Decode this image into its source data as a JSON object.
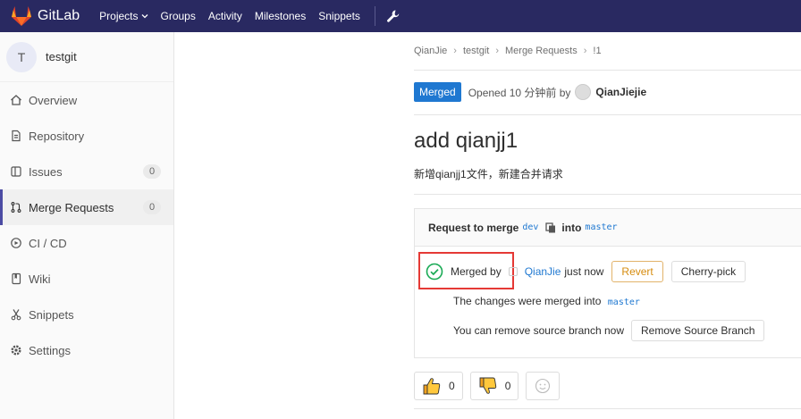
{
  "navbar": {
    "brand": "GitLab",
    "links": [
      "Projects",
      "Groups",
      "Activity",
      "Milestones",
      "Snippets"
    ],
    "colors": {
      "background": "#292961"
    }
  },
  "sidebar": {
    "project_initial": "T",
    "project_name": "testgit",
    "items": [
      {
        "label": "Overview",
        "icon": "home-icon"
      },
      {
        "label": "Repository",
        "icon": "file-icon"
      },
      {
        "label": "Issues",
        "icon": "issues-icon",
        "count": "0"
      },
      {
        "label": "Merge Requests",
        "icon": "merge-request-icon",
        "count": "0",
        "active": true
      },
      {
        "label": "CI / CD",
        "icon": "rocket-icon"
      },
      {
        "label": "Wiki",
        "icon": "book-icon"
      },
      {
        "label": "Snippets",
        "icon": "scissors-icon"
      },
      {
        "label": "Settings",
        "icon": "gear-icon"
      }
    ]
  },
  "breadcrumb": [
    "QianJie",
    "testgit",
    "Merge Requests",
    "!1"
  ],
  "header": {
    "status": "Merged",
    "opened_text": "Opened 10 分钟前 by",
    "author": "QianJiejie"
  },
  "mr": {
    "title": "add qianjj1",
    "description": "新增qianjj1文件，新建合并请求"
  },
  "widget": {
    "request_prefix": "Request to merge",
    "source_branch": "dev",
    "into_label": "into",
    "target_branch": "master",
    "merged_by": "Merged by",
    "merged_user": "QianJie",
    "merged_when": "just now",
    "revert_label": "Revert",
    "cherry_pick_label": "Cherry-pick",
    "merged_into_text": "The changes were merged into",
    "merged_into_branch": "master",
    "remove_text": "You can remove source branch now",
    "remove_button": "Remove Source Branch"
  },
  "awards": {
    "thumbs_up": "0",
    "thumbs_down": "0"
  }
}
